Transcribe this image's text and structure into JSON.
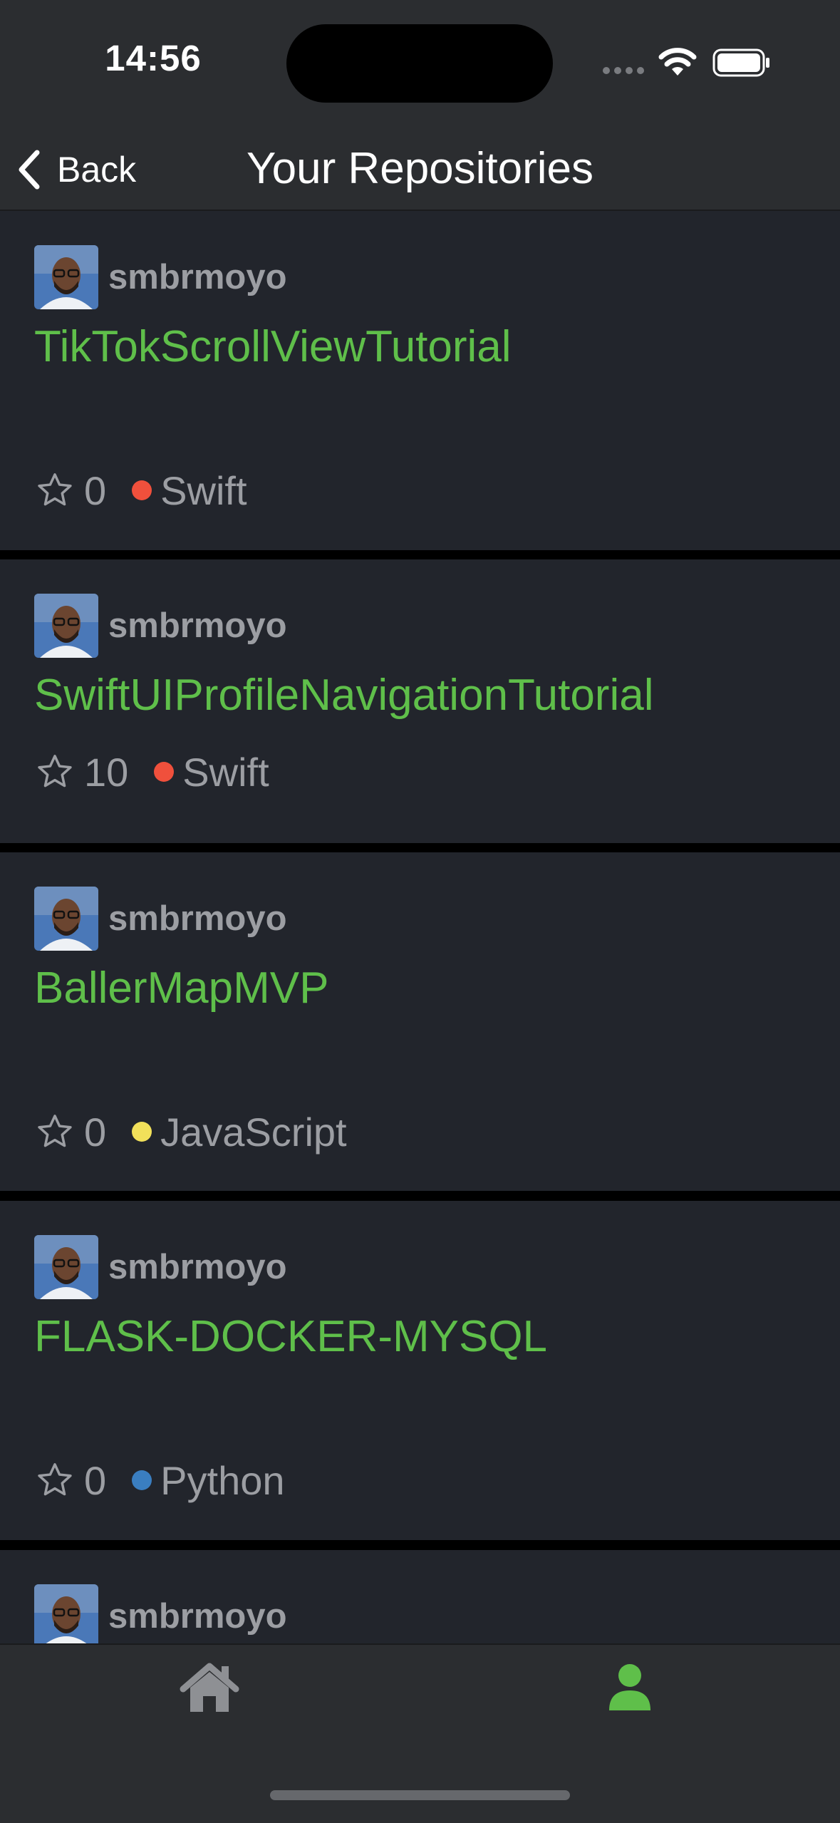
{
  "status_bar": {
    "time": "14:56"
  },
  "nav": {
    "back_label": "Back",
    "title": "Your Repositories"
  },
  "repos": [
    {
      "owner": "smbrmoyo",
      "name": "TikTokScrollViewTutorial",
      "stars": "0",
      "language": "Swift",
      "language_color": "#f0503c"
    },
    {
      "owner": "smbrmoyo",
      "name": "SwiftUIProfileNavigationTutorial",
      "stars": "10",
      "language": "Swift",
      "language_color": "#f0503c"
    },
    {
      "owner": "smbrmoyo",
      "name": "BallerMapMVP",
      "stars": "0",
      "language": "JavaScript",
      "language_color": "#f1e05a"
    },
    {
      "owner": "smbrmoyo",
      "name": "FLASK-DOCKER-MYSQL",
      "stars": "0",
      "language": "Python",
      "language_color": "#3a7ec0"
    },
    {
      "owner": "smbrmoyo"
    }
  ],
  "tab_bar": {
    "items": [
      {
        "icon": "home-icon",
        "selected": false
      },
      {
        "icon": "person-icon",
        "selected": true
      }
    ]
  },
  "colors": {
    "accent": "#5fbf4a",
    "card_background": "#22252c",
    "bar_background": "#2b2d30",
    "secondary_text": "#9c9ea3"
  }
}
